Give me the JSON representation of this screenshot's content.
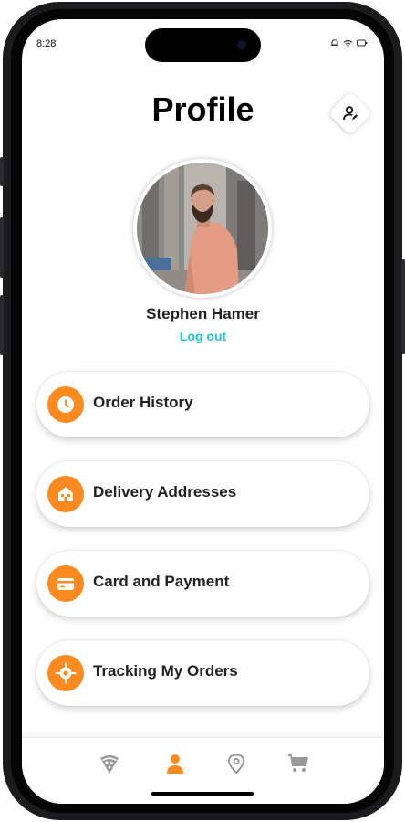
{
  "status_bar": {
    "time": "8:28"
  },
  "header": {
    "title": "Profile"
  },
  "profile": {
    "name": "Stephen Hamer",
    "logout_label": "Log out"
  },
  "menu": {
    "items": [
      {
        "label": "Order History",
        "icon": "clock-icon"
      },
      {
        "label": "Delivery Addresses",
        "icon": "house-icon"
      },
      {
        "label": "Card and Payment",
        "icon": "credit-card-icon"
      },
      {
        "label": "Tracking My Orders",
        "icon": "location-target-icon"
      }
    ]
  },
  "tab_bar": {
    "items": [
      {
        "icon": "pizza-icon",
        "active": false
      },
      {
        "icon": "user-icon",
        "active": true
      },
      {
        "icon": "map-pin-icon",
        "active": false
      },
      {
        "icon": "cart-icon",
        "active": false
      }
    ]
  },
  "colors": {
    "accent": "#fb8a20",
    "link": "#1fc6d6",
    "tab_inactive": "#9a9a9a",
    "text": "#222222"
  }
}
